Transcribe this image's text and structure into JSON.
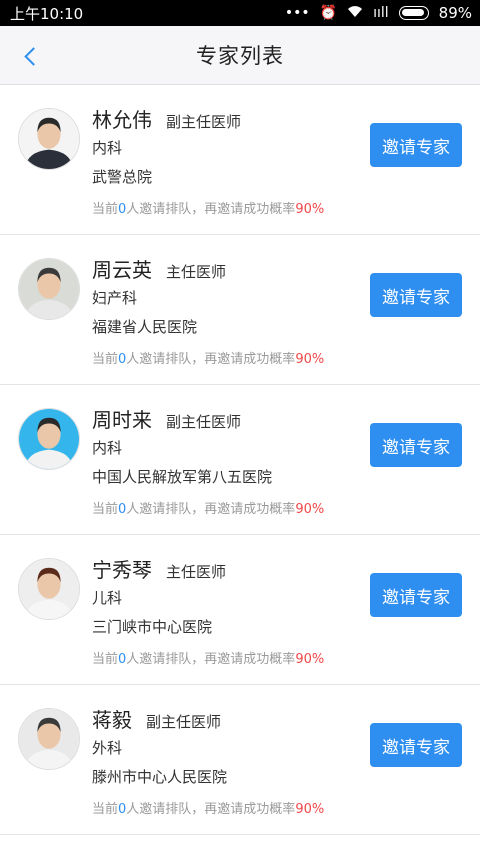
{
  "status_bar": {
    "time": "上午10:10",
    "dots": "•••",
    "alarm_icon": "alarm-icon",
    "wifi_icon": "wifi-icon",
    "signal": "ııll",
    "battery_percent": "89%"
  },
  "header": {
    "title": "专家列表",
    "back_icon": "chevron-left-icon"
  },
  "queue_text": {
    "prefix": "当前",
    "count": "0",
    "middle": "人邀请排队，再邀请成功概率",
    "rate": "90%"
  },
  "invite_label": "邀请专家",
  "experts": [
    {
      "name": "林允伟",
      "title": "副主任医师",
      "department": "内科",
      "hospital": "武警总院",
      "avatar_bg": "#f4f4f4",
      "avatar_hair": "#2a2a2a",
      "avatar_coat": "#2b2f3a"
    },
    {
      "name": "周云英",
      "title": "主任医师",
      "department": "妇产科",
      "hospital": "福建省人民医院",
      "avatar_bg": "#d9dbd6",
      "avatar_hair": "#3a3a3a",
      "avatar_coat": "#e8e8e8"
    },
    {
      "name": "周时来",
      "title": "副主任医师",
      "department": "内科",
      "hospital": "中国人民解放军第八五医院",
      "avatar_bg": "#34b6ec",
      "avatar_hair": "#2a2a2a",
      "avatar_coat": "#f2f2f2"
    },
    {
      "name": "宁秀琴",
      "title": "主任医师",
      "department": "儿科",
      "hospital": "三门峡市中心医院",
      "avatar_bg": "#eeeeee",
      "avatar_hair": "#5a2a1a",
      "avatar_coat": "#f6f6f6"
    },
    {
      "name": "蒋毅",
      "title": "副主任医师",
      "department": "外科",
      "hospital": "滕州市中心人民医院",
      "avatar_bg": "#e9e9e9",
      "avatar_hair": "#3a3a3a",
      "avatar_coat": "#f4f4f4"
    }
  ]
}
